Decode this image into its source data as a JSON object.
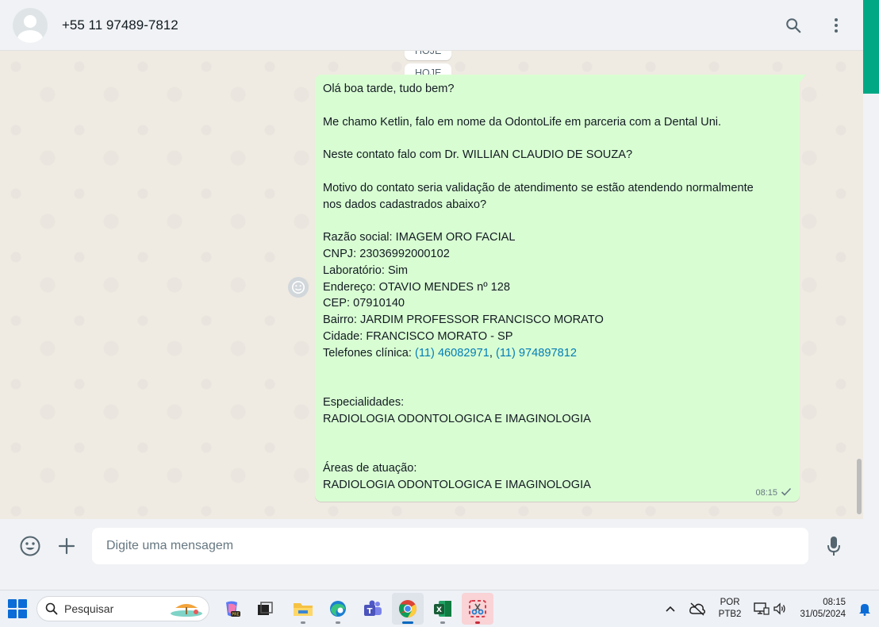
{
  "header": {
    "contact_name": "+55 11 97489-7812",
    "search_icon": "search-icon",
    "menu_icon": "kebab-menu-icon"
  },
  "chat": {
    "date_chips": [
      "HOJE",
      "HOJE"
    ],
    "message": {
      "lines": [
        "Olá boa tarde, tudo bem?",
        "",
        "Me chamo Ketlin, falo em nome da OdontoLife em parceria com a Dental Uni.",
        "",
        "Neste contato falo com Dr. WILLIAN CLAUDIO DE SOUZA?",
        "",
        "Motivo do contato seria validação de atendimento se estão atendendo normalmente",
        "nos dados cadastrados abaixo?",
        "",
        "Razão social: IMAGEM ORO FACIAL",
        "CNPJ: 23036992000102",
        "Laboratório: Sim",
        "Endereço: OTAVIO MENDES nº 128",
        "CEP: 07910140",
        "Bairro: JARDIM PROFESSOR FRANCISCO MORATO",
        "Cidade: FRANCISCO MORATO - SP"
      ],
      "phones_label": "Telefones clínica: ",
      "phone_1": "(11) 46082971",
      "phone_sep": ", ",
      "phone_2": "(11) 974897812",
      "specialties_label": "Especialidades:",
      "specialties_value": "RADIOLOGIA ODONTOLOGICA E IMAGINOLOGIA",
      "areas_label": "Áreas de atuação:",
      "areas_value": "RADIOLOGIA ODONTOLOGICA E IMAGINOLOGIA",
      "time": "08:15",
      "status": "sent"
    }
  },
  "composer": {
    "placeholder": "Digite uma mensagem"
  },
  "taskbar": {
    "search_label": "Pesquisar",
    "lang_top": "POR",
    "lang_bottom": "PTB2",
    "time": "08:15",
    "date": "31/05/2024"
  },
  "colors": {
    "accent": "#00a884",
    "outgoing_bubble": "#d9fdd3",
    "link": "#027eb5"
  }
}
